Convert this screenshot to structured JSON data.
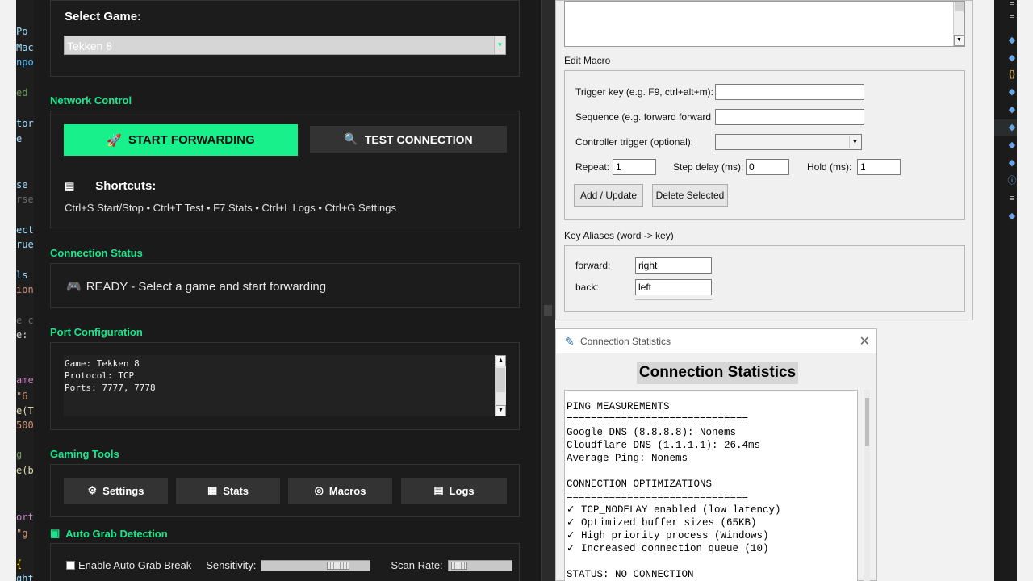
{
  "editor_left": {
    "lines": [
      {
        "text": "Po",
        "color": "#9cdcfe"
      },
      {
        "text": "Mac",
        "color": "#9cdcfe"
      },
      {
        "text": "npo",
        "color": "#4fc1ff"
      },
      {
        "text": "ed",
        "color": "#6a9955"
      },
      {
        "text": "tor",
        "color": "#9cdcfe"
      },
      {
        "text": "e",
        "color": "#9cdcfe"
      },
      {
        "text": "se",
        "color": "#9cdcfe"
      },
      {
        "text": "rse",
        "color": "#6a6a6a"
      },
      {
        "text": "ect",
        "color": "#9cdcfe"
      },
      {
        "text": "rue",
        "color": "#9cdcfe"
      },
      {
        "text": "ls",
        "color": "#9cdcfe"
      },
      {
        "text": "ion",
        "color": "#ce9178"
      },
      {
        "text": "e c",
        "color": "#6a6a6a"
      },
      {
        "text": "e:",
        "color": "#d4d4d4"
      },
      {
        "text": "ame",
        "color": "#c586c0"
      },
      {
        "text": "\"6",
        "color": "#ce9178"
      },
      {
        "text": "e(T",
        "color": "#dcdcaa"
      },
      {
        "text": "500",
        "color": "#ce9178"
      },
      {
        "text": "g",
        "color": "#6a9955"
      },
      {
        "text": "e(b",
        "color": "#dcdcaa"
      },
      {
        "text": "ort",
        "color": "#c586c0"
      },
      {
        "text": "\"g",
        "color": "#ce9178"
      },
      {
        "text": "{",
        "color": "#ffd700"
      },
      {
        "text": "ght",
        "color": "#9cdcfe"
      }
    ]
  },
  "editor_right": {
    "icons": [
      "lines-icon",
      "lines-icon",
      "puzzle-icon",
      "puzzle-icon",
      "braces-icon",
      "puzzle-icon",
      "puzzle-icon",
      "puzzle-icon",
      "puzzle-icon",
      "puzzle-icon",
      "info-icon",
      "lines-icon",
      "puzzle-icon"
    ]
  },
  "app": {
    "select_game_label": "Select Game:",
    "selected_game": "Tekken 8",
    "network_control_title": "Network Control",
    "start_button": "START FORWARDING",
    "test_button": "TEST CONNECTION",
    "shortcuts_title": "Shortcuts:",
    "shortcuts_text": "Ctrl+S Start/Stop • Ctrl+T Test • F7 Stats • Ctrl+L Logs • Ctrl+G Settings",
    "connection_status_title": "Connection Status",
    "status_text": "READY - Select a game and start forwarding",
    "port_config_title": "Port Configuration",
    "port_config_text": "Game: Tekken 8\nProtocol: TCP\nPorts: 7777, 7778",
    "gaming_tools_title": "Gaming Tools",
    "tools": {
      "settings": "Settings",
      "stats": "Stats",
      "macros": "Macros",
      "logs": "Logs"
    },
    "auto_grab_title": "Auto Grab Detection",
    "enable_auto_grab": "Enable Auto Grab Break",
    "sensitivity_label": "Sensitivity:",
    "scan_rate_label": "Scan Rate:",
    "sensitivity_level": 0.78,
    "scan_rate_level": 0.05,
    "accent_color": "#19e68c"
  },
  "macro_editor": {
    "edit_macro_label": "Edit Macro",
    "trigger_key_label": "Trigger key (e.g. F9, ctrl+alt+m):",
    "trigger_key_value": "",
    "sequence_label": "Sequence (e.g. forward forward",
    "sequence_value": "",
    "controller_trigger_label": "Controller trigger (optional):",
    "controller_trigger_value": "",
    "repeat_label": "Repeat:",
    "repeat_value": "1",
    "step_delay_label": "Step delay (ms):",
    "step_delay_value": "0",
    "hold_label": "Hold (ms):",
    "hold_value": "1",
    "add_update_button": "Add / Update",
    "delete_selected_button": "Delete Selected",
    "key_aliases_label": "Key Aliases (word -> key)",
    "aliases": [
      {
        "word": "forward:",
        "key": "right"
      },
      {
        "word": "back:",
        "key": "left"
      }
    ]
  },
  "stats_window": {
    "title": "Connection Statistics",
    "heading": "Connection Statistics",
    "text": "PING MEASUREMENTS\n==============================\nGoogle DNS (8.8.8.8): Nonems\nCloudflare DNS (1.1.1.1): 26.4ms\nAverage Ping: Nonems\n\nCONNECTION OPTIMIZATIONS\n==============================\n✓ TCP_NODELAY enabled (low latency)\n✓ Optimized buffer sizes (65KB)\n✓ High priority process (Windows)\n✓ Increased connection queue (10)\n\nSTATUS: NO CONNECTION"
  }
}
